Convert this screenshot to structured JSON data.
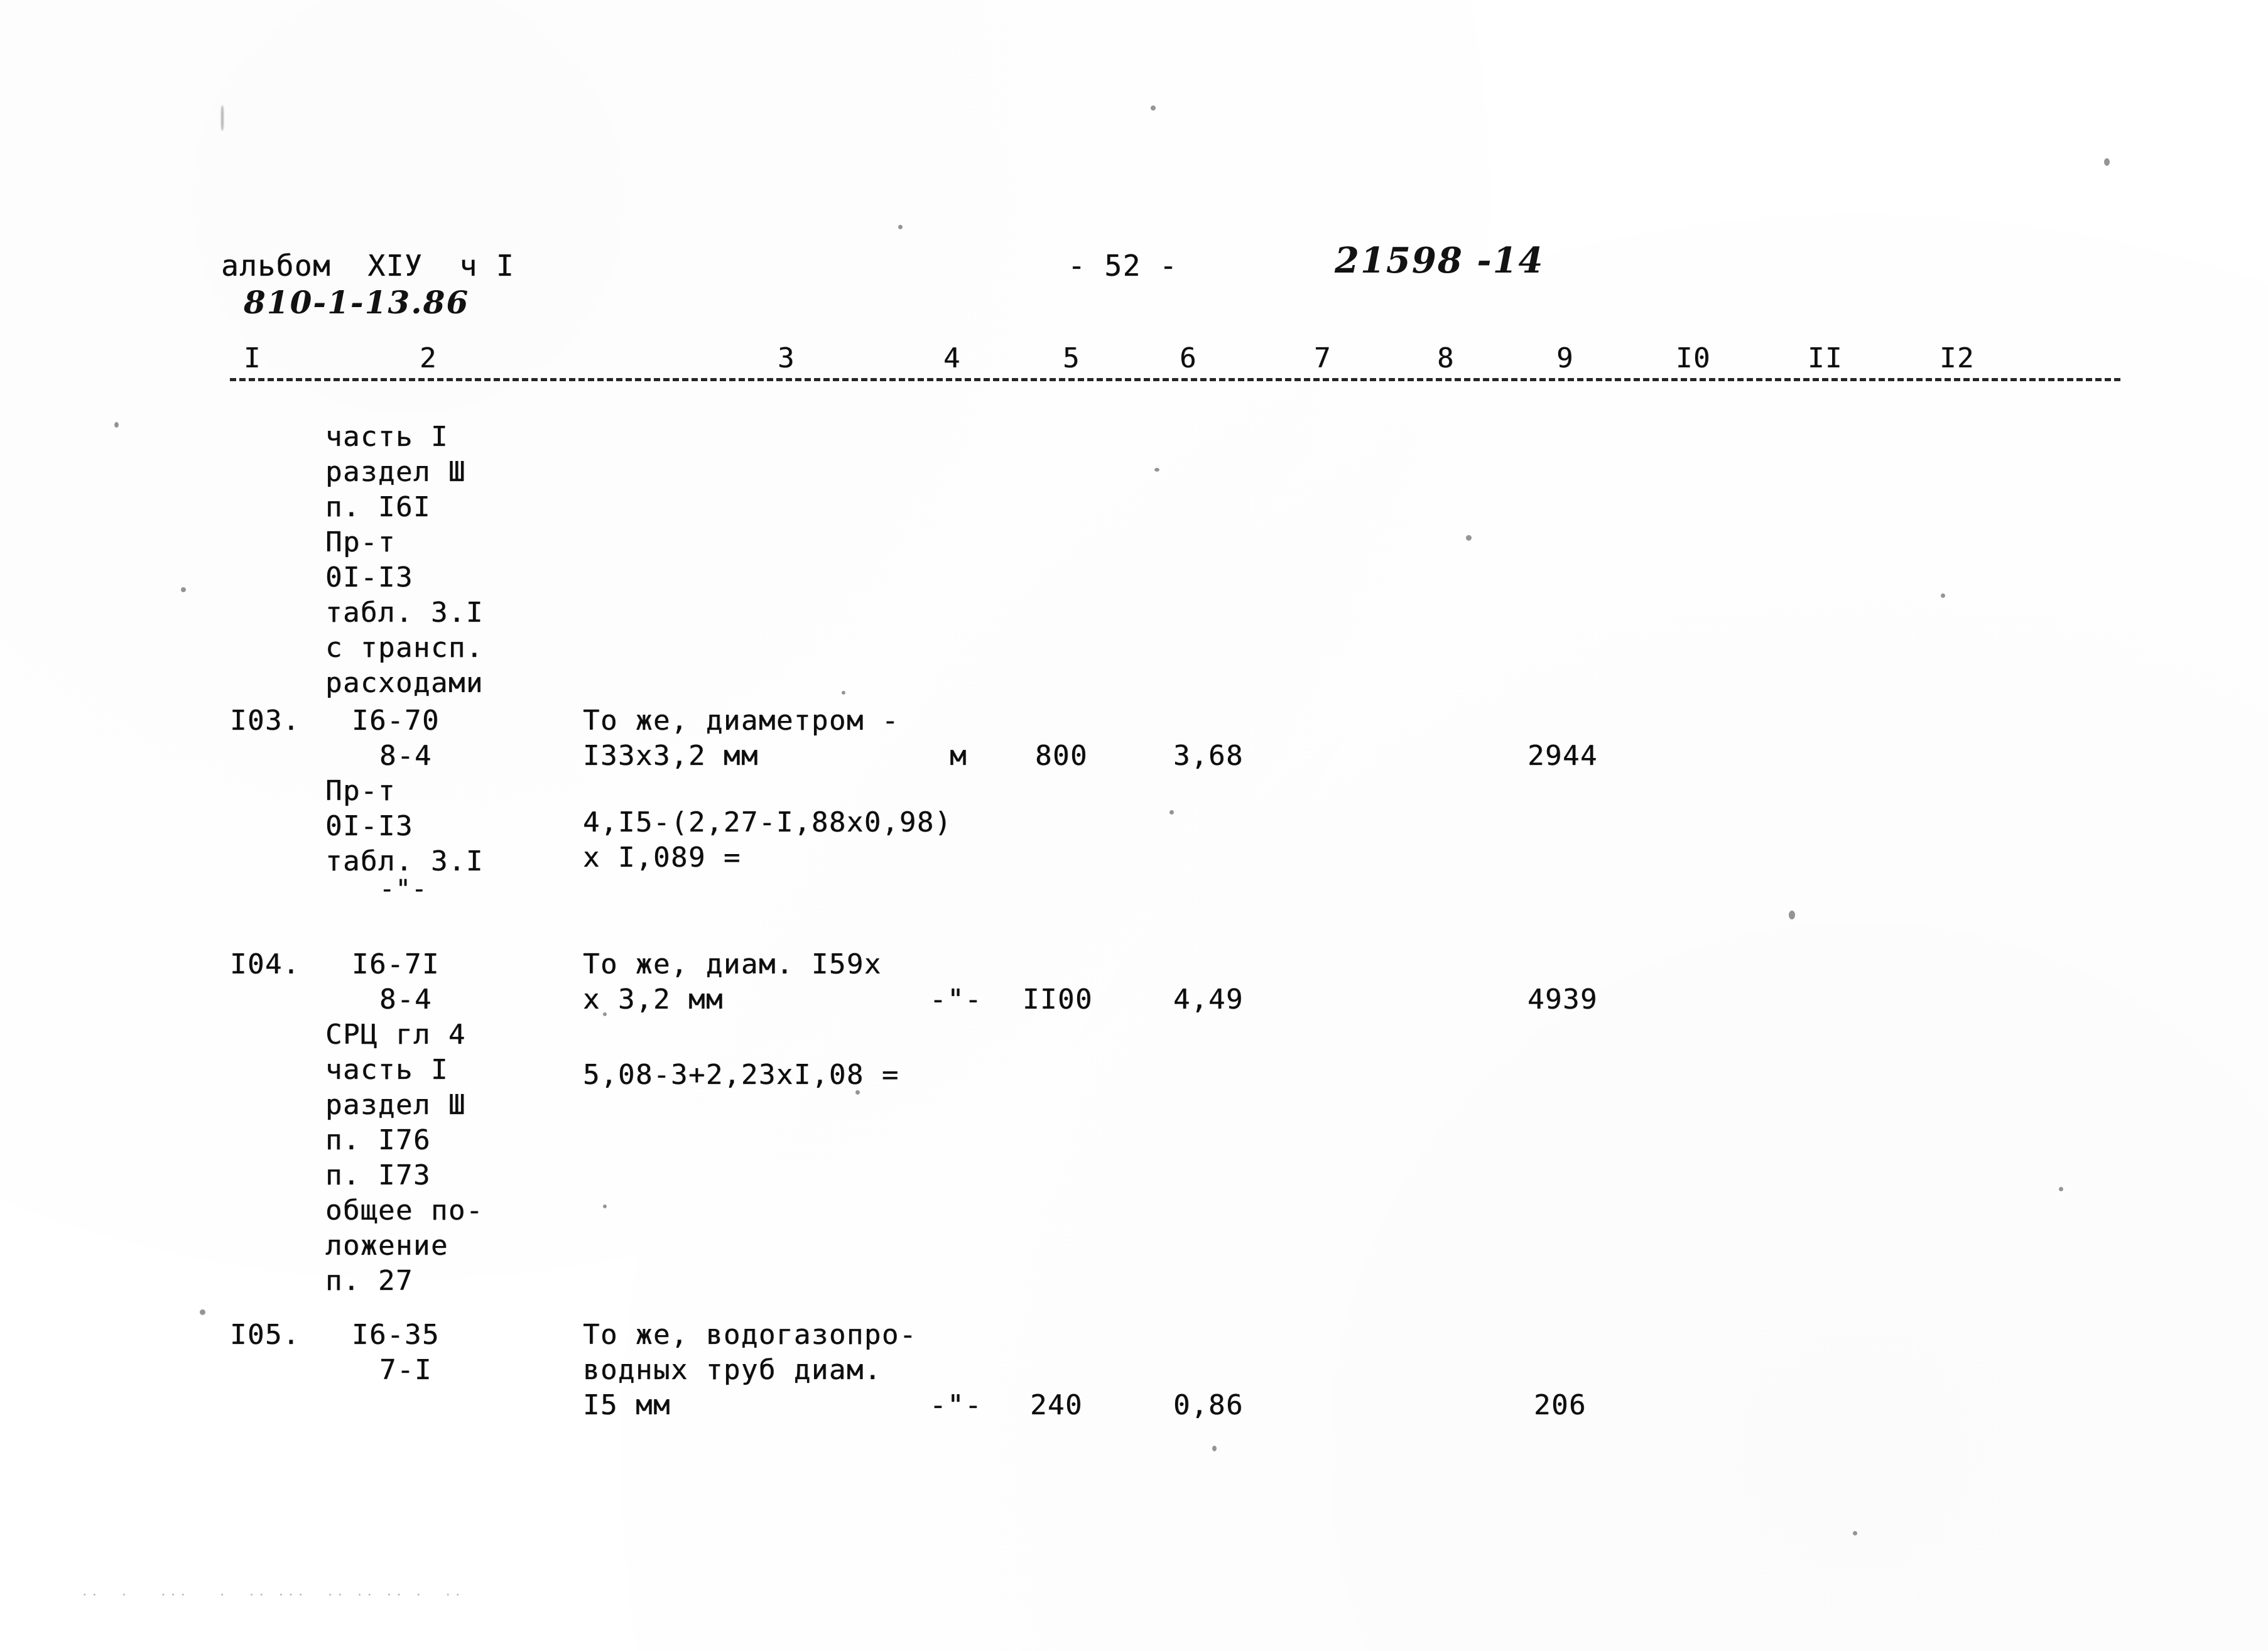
{
  "document": {
    "header": {
      "album_line": "альбом  XIУ  ч I",
      "album_code_handwritten": "810-1-13.86",
      "page_number": "- 52 -",
      "stamp_handwritten": "21598 -14"
    },
    "column_header": {
      "numbers": [
        "I",
        "2",
        "3",
        "4",
        "5",
        "6",
        "7",
        "8",
        "9",
        "I0",
        "II",
        "I2"
      ]
    },
    "continued_block": {
      "lines": [
        "часть I",
        "раздел Ш",
        "п. I6I",
        "Пр-т",
        "0I-I3",
        "табл. 3.I",
        "с трансп.",
        "расходами"
      ]
    },
    "rows": [
      {
        "number": "I03.",
        "code_lines": [
          "I6-70",
          "8-4",
          "Пр-т",
          "0I-I3",
          "табл. 3.I",
          "-\"-"
        ],
        "description_lines": [
          "То же, диаметром -",
          "I33х3,2 мм"
        ],
        "formula_lines": [
          "4,I5-(2,27-I,88х0,98)",
          "х I,089 ="
        ],
        "unit": "м",
        "quantity": "800",
        "price": "3,68",
        "total": "2944"
      },
      {
        "number": "I04.",
        "code_lines": [
          "I6-7I",
          "8-4",
          "СРЦ гл 4",
          "часть I",
          "раздел Ш",
          "п. I76",
          "п. I73",
          "общее по-",
          "ложение",
          "п. 27"
        ],
        "description_lines": [
          "То же, диам. I59х",
          "х 3,2 мм"
        ],
        "formula_lines": [
          "5,08-3+2,23хI,08 ="
        ],
        "unit": "-\"-",
        "quantity": "II00",
        "price": "4,49",
        "total": "4939"
      },
      {
        "number": "I05.",
        "code_lines": [
          "I6-35",
          "7-I"
        ],
        "description_lines": [
          "То же, водогазопро-",
          "водных труб диам.",
          "I5 мм"
        ],
        "formula_lines": [],
        "unit": "-\"-",
        "quantity": "240",
        "price": "0,86",
        "total": "206"
      }
    ],
    "bottom_artifact": "··  ·   ···   ·  ·· ···  ·· ·· ·· ·  ··"
  }
}
